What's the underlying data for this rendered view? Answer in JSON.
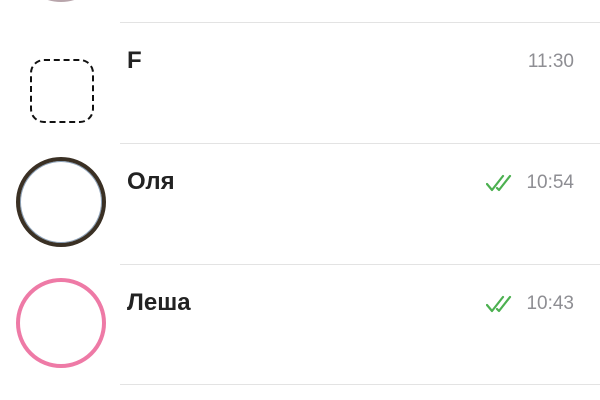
{
  "chats": [
    {
      "name": "F",
      "time": "11:30",
      "read": false
    },
    {
      "name": "Оля",
      "time": "10:54",
      "read": true
    },
    {
      "name": "Леша",
      "time": "10:43",
      "read": true
    }
  ],
  "colors": {
    "read_check": "#4cb050",
    "time": "#8e8e93",
    "name": "#222222",
    "divider": "#e3e3e3",
    "avatar_pink_border": "#ee7aa6"
  },
  "icons": {
    "read_status": "double-check-icon"
  }
}
